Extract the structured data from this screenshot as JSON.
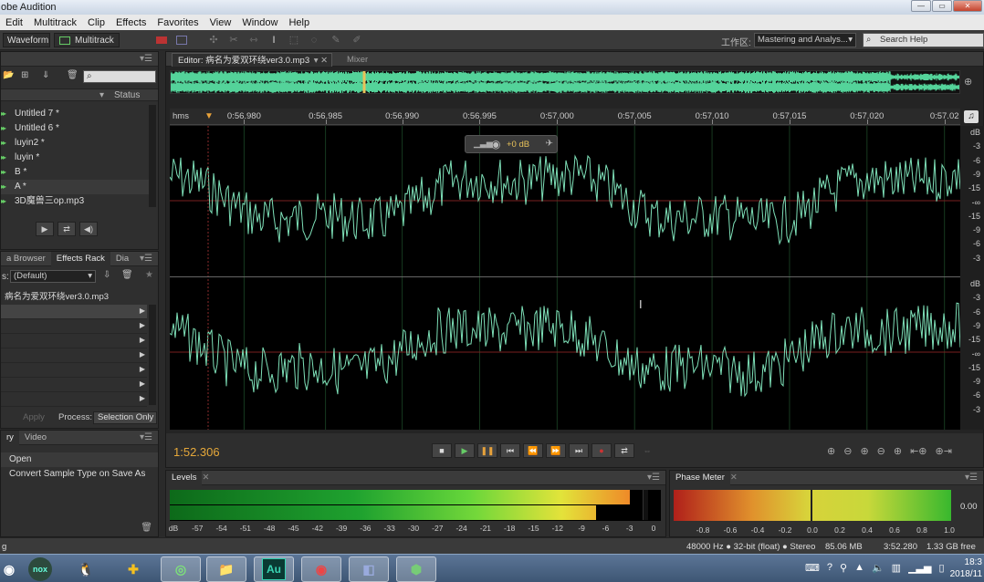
{
  "window": {
    "title": "obe Audition"
  },
  "menu": [
    "Edit",
    "Multitrack",
    "Clip",
    "Effects",
    "Favorites",
    "View",
    "Window",
    "Help"
  ],
  "toolbar": {
    "waveform_label": "Waveform",
    "multitrack_label": "Multitrack",
    "workspace_label": "工作区:",
    "workspace_value": "Mastering and Analys...",
    "search_placeholder": "Search Help"
  },
  "files": {
    "status_header": "Status",
    "items": [
      "Untitled 7 *",
      "Untitled 6 *",
      "luyin2 *",
      "luyin *",
      "B *",
      "A *",
      "3D魔兽三op.mp3"
    ],
    "selected_index": 5
  },
  "effects": {
    "tabs": [
      "a Browser",
      "Effects Rack",
      "Dia"
    ],
    "preset": "(Default)",
    "file_name": "病名为爱双环绕ver3.0.mp3",
    "apply_label": "Apply",
    "process_label": "Process:",
    "process_value": "Selection Only",
    "prefix": "s:"
  },
  "history": {
    "tabs": [
      "ry",
      "Video"
    ],
    "items": [
      "Open",
      "Convert Sample Type on Save As"
    ]
  },
  "editor": {
    "tab_label": "Editor: 病名为爱双环绕ver3.0.mp3",
    "mixer_label": "Mixer",
    "ruler_unit": "hms",
    "ruler_ticks": [
      {
        "label": "0:56.980",
        "pos": 0.094
      },
      {
        "label": "0:56.985",
        "pos": 0.197
      },
      {
        "label": "0:56.990",
        "pos": 0.294
      },
      {
        "label": "0:56.995",
        "pos": 0.392
      },
      {
        "label": "0:57.000",
        "pos": 0.49
      },
      {
        "label": "0:57.005",
        "pos": 0.588
      },
      {
        "label": "0:57.010",
        "pos": 0.686
      },
      {
        "label": "0:57.015",
        "pos": 0.784
      },
      {
        "label": "0:57.020",
        "pos": 0.882
      },
      {
        "label": "0:57.02",
        "pos": 0.98
      }
    ],
    "db_ticks_top": [
      "dB",
      "-3",
      "-6",
      "-9",
      "-15",
      "-∞",
      "-15",
      "-9",
      "-6",
      "-3"
    ],
    "db_ticks_bottom": [
      "dB",
      "-3",
      "-6",
      "-9",
      "-15",
      "-∞",
      "-15",
      "-9",
      "-6",
      "-3"
    ],
    "hud_value": "+0 dB",
    "timecode": "1:52.306",
    "wave_color": "#7ee0b8",
    "overview_color": "#54d39a"
  },
  "levels": {
    "title": "Levels",
    "scale": [
      "dB",
      "-57",
      "-54",
      "-51",
      "-48",
      "-45",
      "-42",
      "-39",
      "-36",
      "-33",
      "-30",
      "-27",
      "-24",
      "-21",
      "-18",
      "-15",
      "-12",
      "-9",
      "-6",
      "-3",
      "0"
    ]
  },
  "phase": {
    "title": "Phase Meter",
    "scale": [
      "-0.8",
      "-0.6",
      "-0.4",
      "-0.2",
      "0.0",
      "0.2",
      "0.4",
      "0.6",
      "0.8",
      "1.0"
    ],
    "value": "0.00"
  },
  "status": {
    "format": "48000 Hz ● 32-bit (float) ● Stereo",
    "size": "85.06 MB",
    "duration": "3:52.280",
    "free": "1.33 GB free",
    "left": "g"
  },
  "taskbar": {
    "clock_time": "18:3",
    "clock_date": "2018/11"
  }
}
